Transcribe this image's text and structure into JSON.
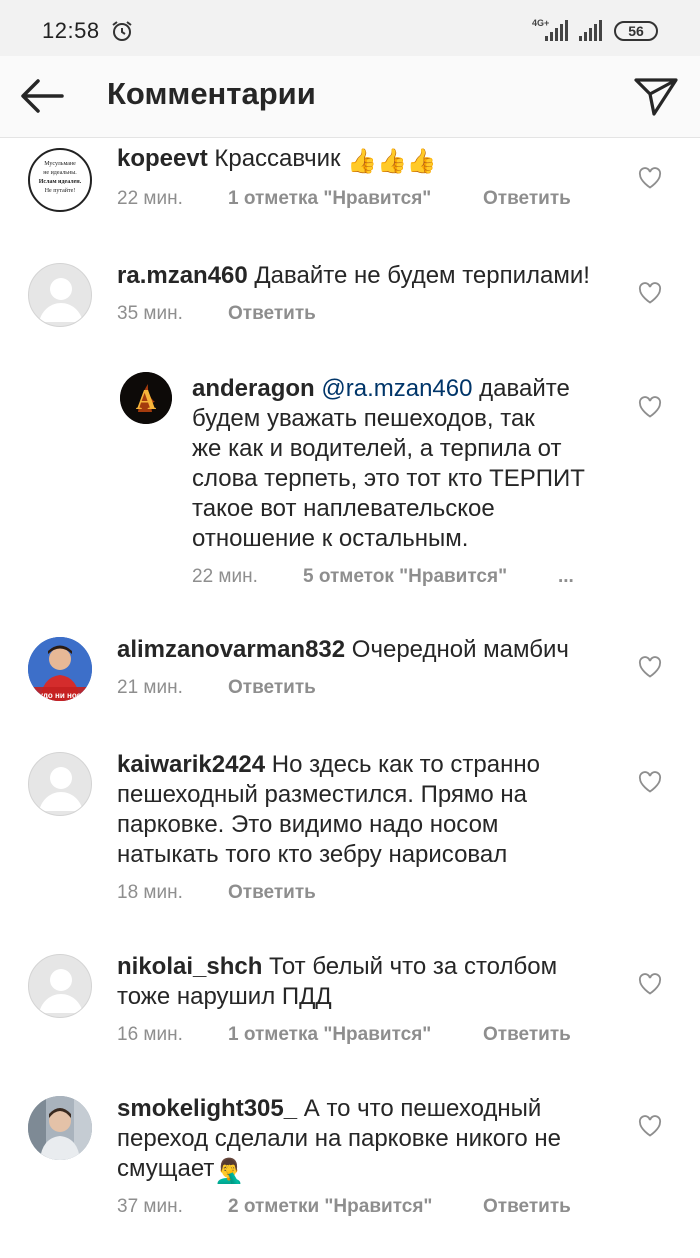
{
  "status_bar": {
    "time": "12:58",
    "network": "4G+",
    "battery": "56"
  },
  "header": {
    "title": "Комментарии"
  },
  "comments": [
    {
      "username": "kopeevt",
      "text": "Крассавчик",
      "emoji": "👍👍👍",
      "time": "22 мин.",
      "likes": "1 отметка \"Нравится\"",
      "reply": "Ответить",
      "avatar_text": [
        "Мусульмане",
        "не идеальны.",
        "Ислам идеален.",
        "Не путайте!"
      ]
    },
    {
      "username": "ra.mzan460",
      "text": "Давайте не будем терпилами!",
      "time": "35 мин.",
      "reply": "Ответить"
    },
    {
      "username": "anderagon",
      "mention": "@ra.mzan460",
      "lines": [
        " давайте",
        "будем уважать пешеходов, так",
        "же как и водителей, а терпила от",
        "слова терпеть, это тот кто ТЕРПИТ",
        "такое вот наплевательское",
        "отношение к остальным."
      ],
      "time": "22 мин.",
      "likes": "5 отметок \"Нравится\"",
      "more": "...",
      "avatar_letter": "A"
    },
    {
      "username": "alimzanovarman832",
      "text": "Очередной мамбич",
      "time": "21 мин.",
      "reply": "Ответить",
      "avatar_caption": "худо ни носи"
    },
    {
      "username": "kaiwarik2424",
      "lines": [
        " Но здесь как то странно",
        "пешеходный разместился. Прямо на",
        "парковке. Это видимо надо носом",
        "натыкать того кто зебру нарисовал"
      ],
      "time": "18 мин.",
      "reply": "Ответить"
    },
    {
      "username": "nikolai_shch",
      "lines": [
        " Тот белый что за столбом",
        "тоже нарушил ПДД"
      ],
      "time": "16 мин.",
      "likes": "1 отметка \"Нравится\"",
      "reply": "Ответить"
    },
    {
      "username": "smokelight305_",
      "lines": [
        " А то что пешеходный",
        "переход сделали на парковке никого не",
        "смущает"
      ],
      "emoji": "🤦‍♂️",
      "time": "37 мин.",
      "likes": "2 отметки \"Нравится\"",
      "reply": "Ответить"
    }
  ],
  "icons": {
    "back": "arrow-left-icon",
    "send": "paper-plane-icon",
    "like": "heart-outline-icon",
    "alarm": "alarm-clock-icon"
  },
  "colors": {
    "text": "#262626",
    "secondary": "#8e8e8e",
    "mention": "#003569",
    "status_bar": "#f2f2f2",
    "header": "#fafafa"
  }
}
